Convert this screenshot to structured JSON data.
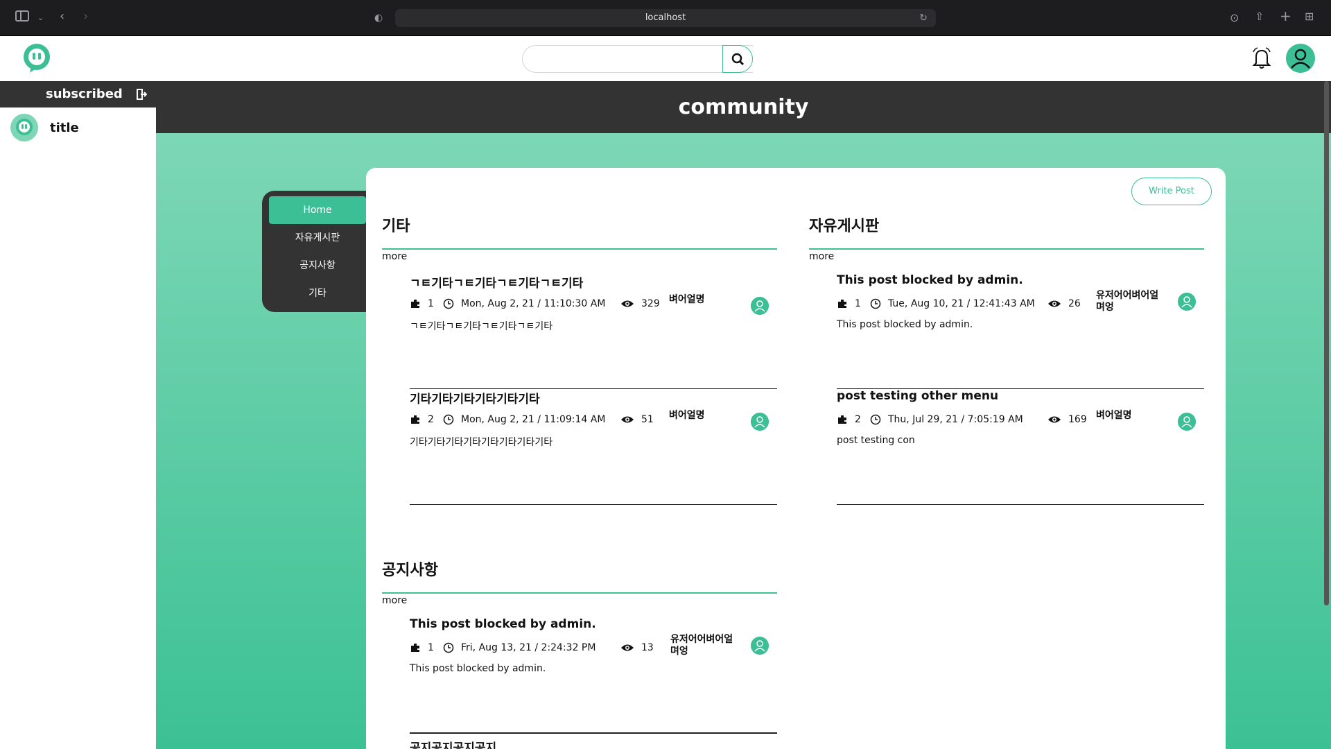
{
  "browser": {
    "url": "localhost"
  },
  "sidebar": {
    "header": "subscribed",
    "items": [
      {
        "label": "title"
      }
    ]
  },
  "community": {
    "title": "community"
  },
  "menu": {
    "items": [
      {
        "label": "Home",
        "active": true
      },
      {
        "label": "자유게시판"
      },
      {
        "label": "공지사항"
      },
      {
        "label": "기타"
      }
    ]
  },
  "write_button": "Write Post",
  "sections": [
    {
      "title": "기타",
      "more": "more",
      "posts": [
        {
          "title": "ㄱㅌ기타ㄱㅌ기타ㄱㅌ기타ㄱㅌ기타",
          "count": "1",
          "date": "Mon, Aug 2, 21 / 11:10:30 AM",
          "views": "329",
          "author": "벼어얼명",
          "excerpt": "ㄱㅌ기타ㄱㅌ기타ㄱㅌ기타ㄱㅌ기타"
        },
        {
          "title": "기타기타기타기타기타기타",
          "count": "2",
          "date": "Mon, Aug 2, 21 / 11:09:14 AM",
          "views": "51",
          "author": "벼어얼명",
          "excerpt": "기타기타기타기타기타기타기타기타"
        }
      ]
    },
    {
      "title": "자유게시판",
      "more": "more",
      "posts": [
        {
          "title": "This post blocked by admin.",
          "count": "1",
          "date": "Tue, Aug 10, 21 / 12:41:43 AM",
          "views": "26",
          "author": "유저어어벼어얼며엉",
          "excerpt": "This post blocked by admin."
        },
        {
          "title": "post testing other menu",
          "count": "2",
          "date": "Thu, Jul 29, 21 / 7:05:19 AM",
          "views": "169",
          "author": "벼어얼명",
          "excerpt": "post testing con"
        }
      ]
    },
    {
      "title": "공지사항",
      "more": "more",
      "posts": [
        {
          "title": "This post blocked by admin.",
          "count": "1",
          "date": "Fri, Aug 13, 21 / 2:24:32 PM",
          "views": "13",
          "author": "유저어어벼어얼며엉",
          "excerpt": "This post blocked by admin."
        },
        {
          "title": "공지공지공지공지",
          "count": "",
          "date": "",
          "views": "",
          "author": "",
          "excerpt": ""
        }
      ]
    }
  ],
  "colors": {
    "accent": "#3cbf95",
    "dark": "#333333"
  }
}
